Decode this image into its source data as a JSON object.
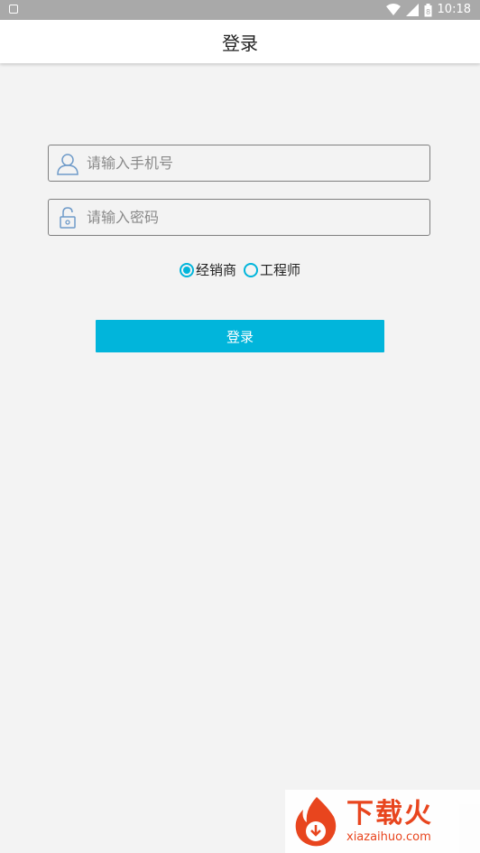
{
  "status_bar": {
    "time": "10:18",
    "battery_text": "8"
  },
  "app_bar": {
    "title": "登录"
  },
  "form": {
    "phone_placeholder": "请输入手机号",
    "password_placeholder": "请输入密码",
    "roles": [
      {
        "label": "经销商",
        "selected": true
      },
      {
        "label": "工程师",
        "selected": false
      }
    ],
    "login_label": "登录"
  },
  "watermark": {
    "brand_cn": "下载火",
    "brand_en": "xiazaihuo.com"
  },
  "colors": {
    "accent": "#01b5db",
    "background": "#f3f3f3",
    "brand": "#e8451e"
  },
  "icons": {
    "phone_field": "user-icon",
    "password_field": "lock-icon",
    "status": [
      "wifi-icon",
      "signal-icon",
      "battery-icon"
    ]
  }
}
